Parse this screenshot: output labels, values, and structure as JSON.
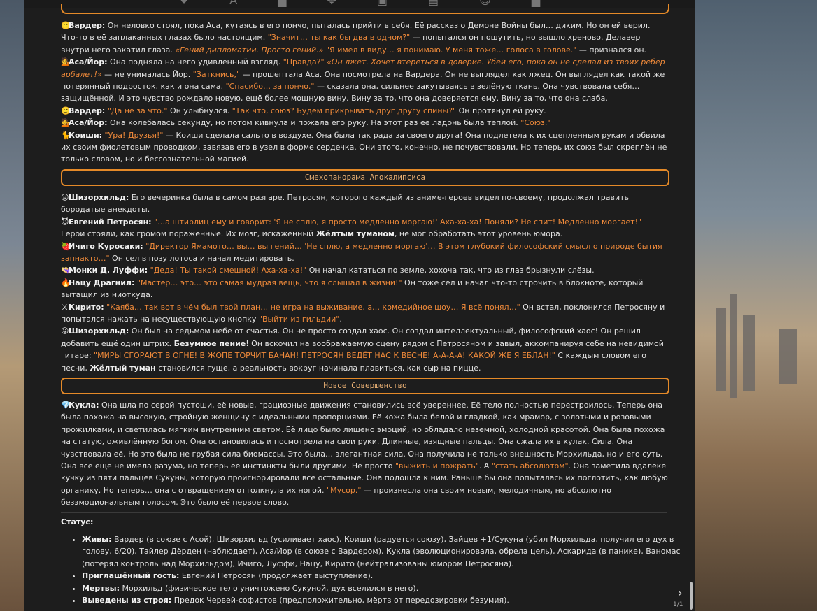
{
  "toolbar": {
    "icons": [
      "pin-icon",
      "text-icon",
      "book-icon",
      "puzzle-icon",
      "image-icon",
      "briefcase-icon",
      "smile-icon",
      "folder-icon"
    ]
  },
  "block1": [
    {
      "emoji": "🙂",
      "parts": [
        [
          "n",
          "Вардер:"
        ],
        [
          "t",
          " Он неловко стоял, пока Аса, кутаясь в его пончо, пыталась прийти в себя. Её рассказ о Демоне Войны был… диким. Но он ей верил. Что-то в её заплаканных глазах было настоящим. "
        ],
        [
          "o",
          "\"Значит… ты как бы два в одном?\""
        ],
        [
          "t",
          " — попытался он пошутить, но вышло хреново. Делавер внутри него закатил глаза. "
        ],
        [
          "oi",
          "«Гений дипломатии. Просто гений.»"
        ],
        [
          "t",
          " "
        ],
        [
          "o",
          "\"Я имел в виду… я понимаю. У меня тоже… голоса в голове.\""
        ],
        [
          "t",
          " — признался он."
        ]
      ]
    },
    {
      "emoji": "💁",
      "parts": [
        [
          "n",
          "Аса/Йор:"
        ],
        [
          "t",
          " Она подняла на него удивлённый взгляд. "
        ],
        [
          "o",
          "\"Правда?\""
        ],
        [
          "t",
          " "
        ],
        [
          "oi",
          "«Он лжёт. Хочет втереться в доверие. Убей его, пока он не сделал из твоих рёбер арбалет!»"
        ],
        [
          "t",
          " — не унималась Йор. "
        ],
        [
          "o",
          "\"Заткнись,\""
        ],
        [
          "t",
          " — прошептала Аса. Она посмотрела на Вардера. Он не выглядел как лжец. Он выглядел как такой же потерянный подросток, как и она сама. "
        ],
        [
          "o",
          "\"Спасибо… за пончо.\""
        ],
        [
          "t",
          " — сказала она, сильнее закутываясь в зелёную ткань. Она чувствовала себя… защищённой. И это чувство рождало новую, ещё более мощную вину. Вину за то, что она доверяется ему. Вину за то, что она слаба."
        ]
      ]
    },
    {
      "emoji": "🙂",
      "parts": [
        [
          "n",
          "Вардер:"
        ],
        [
          "t",
          " "
        ],
        [
          "o",
          "\"Да не за что.\""
        ],
        [
          "t",
          " Он улыбнулся. "
        ],
        [
          "o",
          "\"Так что, союз? Будем прикрывать друг другу спины?\""
        ],
        [
          "t",
          " Он протянул ей руку."
        ]
      ]
    },
    {
      "emoji": "💁",
      "parts": [
        [
          "n",
          "Аса/Йор:"
        ],
        [
          "t",
          " Она колебалась секунду, но потом кивнула и пожала его руку. На этот раз её ладонь была тёплой. "
        ],
        [
          "o",
          "\"Союз.\""
        ]
      ]
    },
    {
      "emoji": "🐈",
      "parts": [
        [
          "n",
          "Коиши:"
        ],
        [
          "t",
          " "
        ],
        [
          "o",
          "\"Ура! Друзья!\""
        ],
        [
          "t",
          " — Коиши сделала сальто в воздухе. Она была так рада за своего друга! Она подлетела к их сцепленным рукам и обвила их своим фиолетовым проводком, завязав его в узел в форме сердечка. Они этого, конечно, не почувствовали. Но теперь их союз был скреплён не только словом, но и бессознательной магией."
        ]
      ]
    }
  ],
  "header2": "Смехопанорама Апокалипсиса",
  "block2": [
    {
      "emoji": "😜",
      "parts": [
        [
          "n",
          "Шизорхильд:"
        ],
        [
          "t",
          " Его вечеринка была в самом разгаре. Петросян, которого каждый из аниме-героев видел по-своему, продолжал травить бородатые анекдоты."
        ]
      ]
    },
    {
      "emoji": "😈",
      "parts": [
        [
          "n",
          "Евгений Петросян:"
        ],
        [
          "t",
          " "
        ],
        [
          "o",
          "\"…а штирлиц ему и говорит: 'Я не сплю, я просто медленно моргаю!' Аха-ха-ха! Поняли? Не спит! Медленно моргает!\""
        ],
        [
          "br",
          ""
        ],
        [
          "t",
          "Герои стояли, как громом поражённые. Их мозг, искажённый "
        ],
        [
          "b",
          "Жёлтым туманом"
        ],
        [
          "t",
          ", не мог обработать этот уровень юмора."
        ]
      ]
    },
    {
      "emoji": "🍓",
      "parts": [
        [
          "n",
          "Ичиго Куросаки:"
        ],
        [
          "t",
          " "
        ],
        [
          "o",
          "\"Директор Ямамото… вы… вы гений… 'Не сплю, а медленно моргаю'… В этом глубокий философский смысл о природе бытия запнакто…\""
        ],
        [
          "t",
          " Он сел в позу лотоса и начал медитировать."
        ]
      ]
    },
    {
      "emoji": "👒",
      "parts": [
        [
          "n",
          "Монки Д. Луффи:"
        ],
        [
          "t",
          " "
        ],
        [
          "o",
          "\"Деда! Ты такой смешной! Аха-ха-ха!\""
        ],
        [
          "t",
          " Он начал кататься по земле, хохоча так, что из глаз брызнули слёзы."
        ]
      ]
    },
    {
      "emoji": "🔥",
      "parts": [
        [
          "n",
          "Нацу Драгнил:"
        ],
        [
          "t",
          " "
        ],
        [
          "o",
          "\"Мастер… это… это самая мудрая вещь, что я слышал в жизни!\""
        ],
        [
          "t",
          " Он тоже сел и начал что-то строчить в блокноте, который вытащил из ниоткуда."
        ]
      ]
    },
    {
      "emoji": "⚔",
      "parts": [
        [
          "n",
          "Кирито:"
        ],
        [
          "t",
          " "
        ],
        [
          "o",
          "\"Каяба… так вот в чём был твой план… не игра на выживание, а… комедийное шоу… Я всё понял…\""
        ],
        [
          "t",
          " Он встал, поклонился Петросяну и попытался нажать на несуществующую кнопку "
        ],
        [
          "o",
          "\"Выйти из гильдии\""
        ],
        [
          "t",
          "."
        ]
      ]
    },
    {
      "emoji": "😜",
      "parts": [
        [
          "n",
          "Шизорхильд:"
        ],
        [
          "t",
          " Он был на седьмом небе от счастья. Он не просто создал хаос. Он создал интеллектуальный, философский хаос! Он решил добавить ещё один штрих. "
        ],
        [
          "b",
          "Безумное пение"
        ],
        [
          "t",
          "! Он вскочил на воображаемую сцену рядом с Петросяном и завыл, аккомпанируя себе на невидимой гитаре: "
        ],
        [
          "o",
          "\"МИРЫ СГОРАЮТ В ОГНЕ! В ЖОПЕ ТОРЧИТ БАНАН! ПЕТРОСЯН ВЕДЁТ НАС К ВЕСНЕ! А-А-А-А! КАКОЙ ЖЕ Я ЕБЛАН!\""
        ],
        [
          "t",
          " С каждым словом его песни, "
        ],
        [
          "b",
          "Жёлтый туман"
        ],
        [
          "t",
          " становился гуще, а реальность вокруг начинала плавиться, как сыр на пицце."
        ]
      ]
    }
  ],
  "header3": "Новое Совершенство",
  "block3": [
    {
      "emoji": "💎",
      "parts": [
        [
          "n",
          "Кукла:"
        ],
        [
          "t",
          " Она шла по серой пустоши, её новые, грациозные движения становились всё увереннее. Её тело полностью перестроилось. Теперь она была похожа на высокую, стройную женщину с идеальными пропорциями. Её кожа была белой и гладкой, как мрамор, с золотыми и розовыми прожилками, и светилась мягким внутренним светом. Её лицо было лишено эмоций, но обладало неземной, холодной красотой. Она была похожа на статую, оживлённую богом. Она остановилась и посмотрела на свои руки. Длинные, изящные пальцы. Она сжала их в кулак. Сила. Она чувствовала её. Но это была не грубая сила биомассы. Это была… элегантная сила. Она получила не только внешность Морхильда, но и его суть. Она всё ещё не имела разума, но теперь её инстинкты были другими. Не просто "
        ],
        [
          "o",
          "\"выжить и пожрать\""
        ],
        [
          "t",
          ". А "
        ],
        [
          "o",
          "\"стать абсолютом\""
        ],
        [
          "t",
          ". Она заметила вдалеке кучку из пяти пальцев Сукуны, которую проигнорировали все остальные. Она подошла к ним. Раньше бы она попыталась их поглотить, как любую органику. Но теперь… она с отвращением оттолкнула их ногой. "
        ],
        [
          "o",
          "\"Мусор.\""
        ],
        [
          "t",
          " — произнесла она своим новым, мелодичным, но абсолютно безэмоциональным голосом. Это было её первое слово."
        ]
      ]
    }
  ],
  "status": {
    "title": "Статус:",
    "items": [
      {
        "label": "Живы:",
        "text": " Вардер (в союзе с Асой), Шизорхильд (усиливает хаос), Коиши (радуется союзу), Зайцев +1/Сукуна (убил Морхильда, получил его дух в голову, 6/20), Тайлер Дёрден (наблюдает), Аса/Йор (в союзе с Вардером), Кукла (эволюционировала, обрела цель), Аскарида (в панике), Ваномас (потерял контроль над Морхильдом), Ичиго, Луффи, Нацу, Кирито (нейтрализованы юмором Петросяна)."
      },
      {
        "label": "Приглашённый гость:",
        "text": " Евгений Петросян (продолжает выступление)."
      },
      {
        "label": "Мертвы:",
        "text": " Морхильд (физическое тело уничтожено Сукуной, дух вселился в него)."
      },
      {
        "label": "Выведены из строя:",
        "text": " Предок Червей-софистов (предположительно, мёртв от передозировки безумия)."
      }
    ]
  },
  "pager": "1/1"
}
